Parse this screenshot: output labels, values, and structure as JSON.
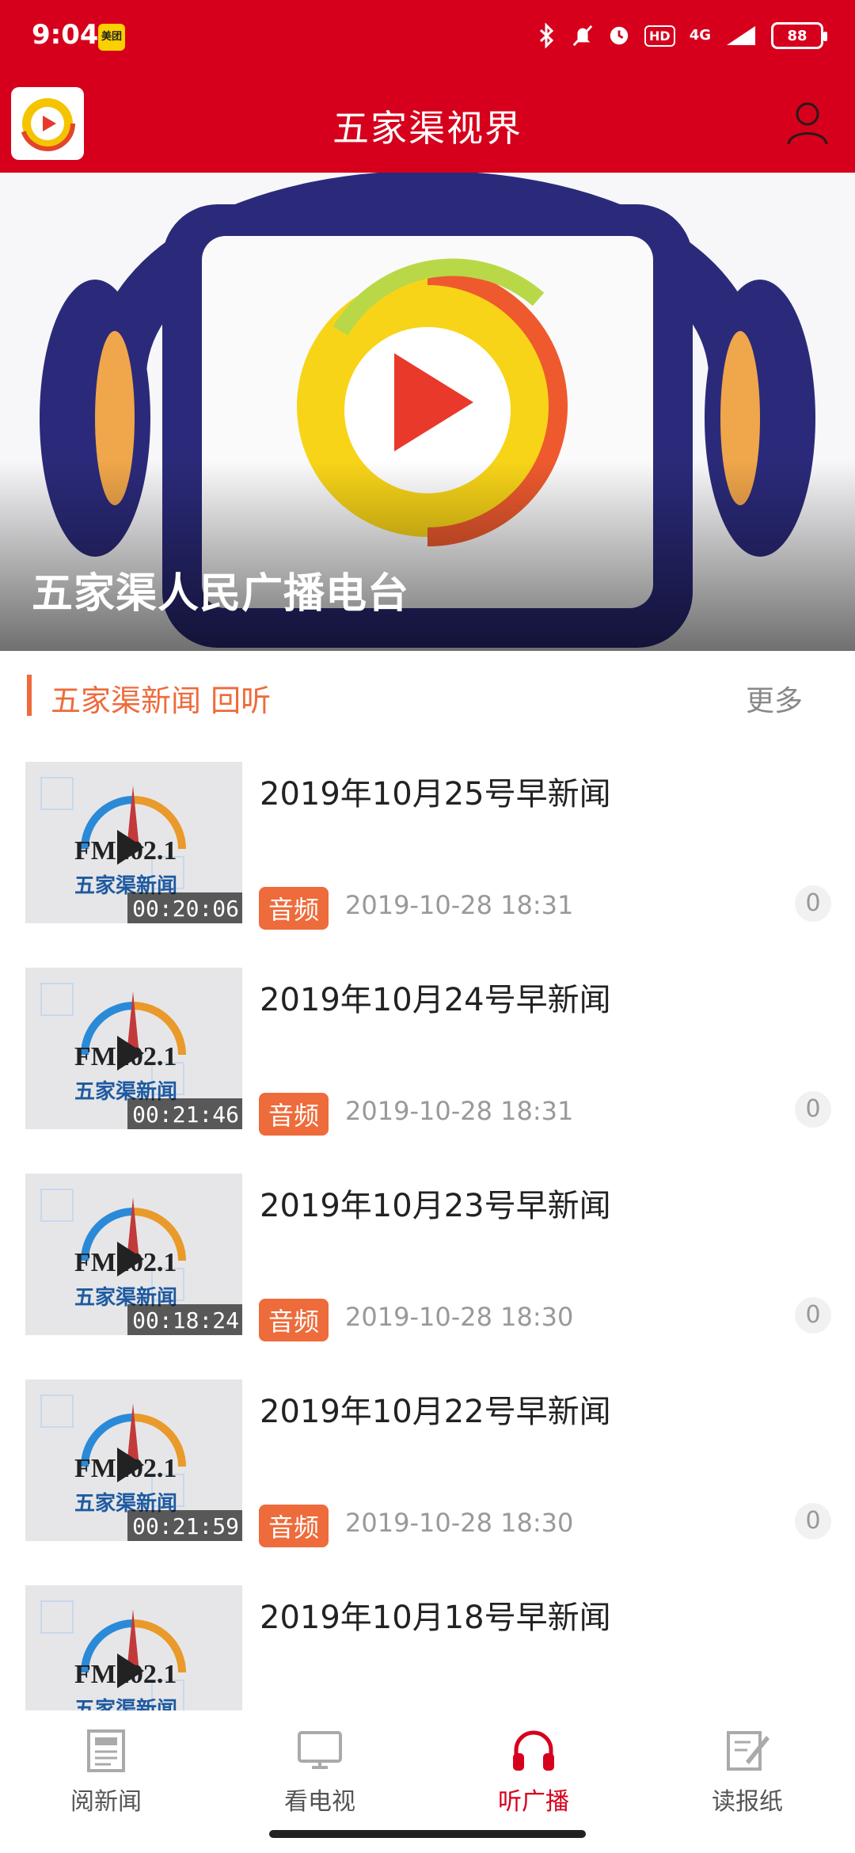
{
  "status_bar": {
    "time": "9:04",
    "meituan_badge": "美团",
    "network": "4G",
    "hd": "HD",
    "battery": "88"
  },
  "header": {
    "title": "五家渠视界"
  },
  "banner": {
    "caption": "五家渠人民广播电台"
  },
  "section": {
    "title": "五家渠新闻 回听",
    "more": "更多"
  },
  "list": [
    {
      "title": "2019年10月25号早新闻",
      "duration": "00:20:06",
      "tag": "音频",
      "date": "2019-10-28 18:31",
      "comments": "0"
    },
    {
      "title": "2019年10月24号早新闻",
      "duration": "00:21:46",
      "tag": "音频",
      "date": "2019-10-28 18:31",
      "comments": "0"
    },
    {
      "title": "2019年10月23号早新闻",
      "duration": "00:18:24",
      "tag": "音频",
      "date": "2019-10-28 18:30",
      "comments": "0"
    },
    {
      "title": "2019年10月22号早新闻",
      "duration": "00:21:59",
      "tag": "音频",
      "date": "2019-10-28 18:30",
      "comments": "0"
    },
    {
      "title": "2019年10月18号早新闻",
      "duration": "",
      "tag": "",
      "date": "",
      "comments": ""
    }
  ],
  "thumb_text": {
    "fm": "FM102.1",
    "station": "五家渠新闻"
  },
  "bottom_nav": [
    {
      "label": "阅新闻",
      "icon": "newspaper-icon",
      "active": false
    },
    {
      "label": "看电视",
      "icon": "tv-icon",
      "active": false
    },
    {
      "label": "听广播",
      "icon": "headphones-icon",
      "active": true
    },
    {
      "label": "读报纸",
      "icon": "paper-pen-icon",
      "active": false
    }
  ],
  "colors": {
    "brand_red": "#d6001c",
    "accent_orange": "#ee6b3b"
  }
}
